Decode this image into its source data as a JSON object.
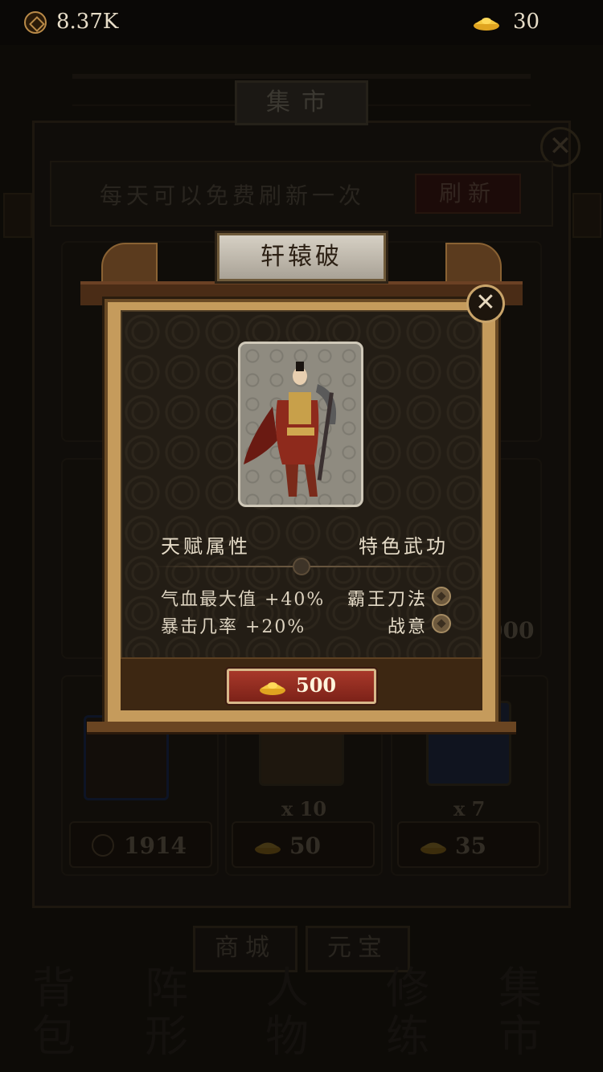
{
  "topbar": {
    "coins": {
      "icon": "coin-icon",
      "value": "8.37K"
    },
    "ingots": {
      "icon": "gold-ingot-icon",
      "value": "30"
    }
  },
  "market": {
    "title": "集市",
    "info_text": "每天可以免费刷新一次",
    "refresh_label": "刷新",
    "partial_price": "000",
    "items": [
      {
        "quantity": "",
        "price": "1914",
        "currency": "coin-icon"
      },
      {
        "quantity": "x 10",
        "price": "50",
        "currency": "gold-ingot-icon"
      },
      {
        "quantity": "x 7",
        "price": "35",
        "currency": "gold-ingot-icon"
      }
    ],
    "tabs": [
      "商城",
      "元宝"
    ],
    "bottom_nav": [
      "背包",
      "阵形",
      "人物",
      "修练",
      "集市"
    ]
  },
  "popup": {
    "title": "轩辕破",
    "talent_header": "天赋属性",
    "skills_header": "特色武功",
    "stats": [
      "气血最大值 +40%",
      "暴击几率 +20%"
    ],
    "skills": [
      "霸王刀法",
      "战意"
    ],
    "price": "500",
    "price_currency": "gold-ingot-icon",
    "close_label": "✕"
  },
  "colors": {
    "accent_gold": "#c59b5c",
    "buy_button": "#a8382a",
    "text_light": "#e6dcc8"
  }
}
